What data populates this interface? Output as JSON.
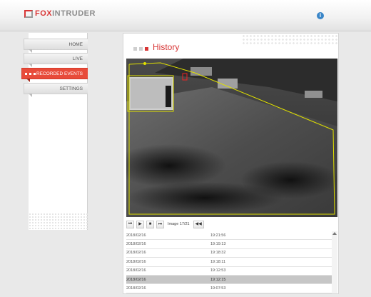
{
  "header": {
    "logo_part1": "FOX",
    "logo_part2": "INTRUDER",
    "logo_subtitle": "",
    "info_icon": "info-icon",
    "info_glyph": "i"
  },
  "nav": {
    "items": [
      {
        "label": "HOME",
        "active": false
      },
      {
        "label": "LIVE",
        "active": false
      },
      {
        "label": "RECORDED EVENTS",
        "active": true
      },
      {
        "label": "SETTINGS",
        "active": false
      }
    ]
  },
  "main": {
    "title": "History",
    "accent_color": "#d83535",
    "player": {
      "image_counter": "Image 17/21",
      "buttons": [
        "first-frame-icon",
        "play-icon",
        "stop-icon",
        "last-frame-icon",
        "rewind-icon"
      ]
    },
    "events": [
      {
        "date": "2018/02/16",
        "time": "19:21:56",
        "selected": false
      },
      {
        "date": "2018/02/16",
        "time": "19:19:13",
        "selected": false
      },
      {
        "date": "2018/02/16",
        "time": "19:18:32",
        "selected": false
      },
      {
        "date": "2018/02/16",
        "time": "19:18:11",
        "selected": false
      },
      {
        "date": "2018/02/16",
        "time": "19:12:53",
        "selected": false
      },
      {
        "date": "2018/02/16",
        "time": "19:12:15",
        "selected": true
      },
      {
        "date": "2018/02/16",
        "time": "19:07:53",
        "selected": false
      }
    ]
  }
}
